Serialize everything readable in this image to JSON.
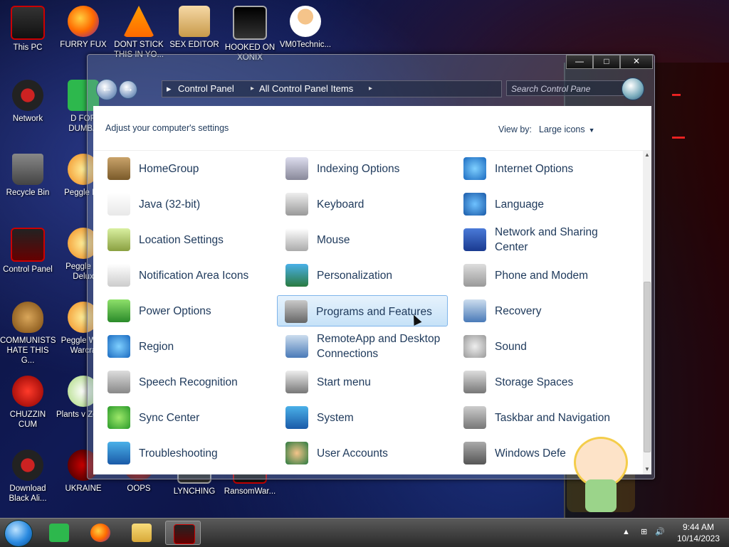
{
  "desktop_icons": [
    {
      "label": "This PC",
      "icon": "this-pc-icon"
    },
    {
      "label": "FURRY FUX",
      "icon": "firefox-icon"
    },
    {
      "label": "DONT STICK THIS IN YO...",
      "icon": "vlc-icon"
    },
    {
      "label": "SEX EDITOR",
      "icon": "hxd-icon"
    },
    {
      "label": "HOOKED ON XONIX",
      "icon": "xonix-icon"
    },
    {
      "label": "VM0Technic...",
      "icon": "doctor-icon"
    },
    {
      "label": "Network",
      "icon": "network-icon"
    },
    {
      "label": "D FOR DUMBA",
      "icon": "green-app-icon"
    },
    {
      "label": "Recycle Bin",
      "icon": "recycle-bin-icon"
    },
    {
      "label": "Peggle De",
      "icon": "peggle-icon"
    },
    {
      "label": "Control Panel",
      "icon": "control-panel-icon"
    },
    {
      "label": "Peggle Ni Delux",
      "icon": "peggle-icon"
    },
    {
      "label": "COMMUNISTS HATE THIS G...",
      "icon": "money-bag-icon"
    },
    {
      "label": "Peggle W of Warcra",
      "icon": "peggle-icon"
    },
    {
      "label": "CHUZZIN CUM",
      "icon": "chuzzle-icon"
    },
    {
      "label": "Plants v Zombi",
      "icon": "plant-icon"
    },
    {
      "label": "Download Black Ali...",
      "icon": "alien-icon"
    },
    {
      "label": "UKRAINE",
      "icon": "radiation-icon"
    },
    {
      "label": "OOPS",
      "icon": "oops-icon"
    },
    {
      "label": "LYNCHING",
      "icon": "lynching-icon"
    },
    {
      "label": "RansomWar...",
      "icon": "ransomware-icon"
    }
  ],
  "window": {
    "controls": {
      "minimize": "—",
      "maximize": "□",
      "close": "✕"
    },
    "address": {
      "crumbs": [
        "Control Panel",
        "All Control Panel Items"
      ],
      "separator": "▸"
    },
    "search_placeholder": "Search Control Pane",
    "header": {
      "adjust_text": "Adjust your computer's settings",
      "view_by_label": "View by:",
      "view_by_value": "Large icons",
      "dropdown_arrow": "▼"
    },
    "items": [
      {
        "label": "HomeGroup",
        "icon": "homegroup-icon"
      },
      {
        "label": "Indexing Options",
        "icon": "indexing-icon"
      },
      {
        "label": "Internet Options",
        "icon": "internet-options-icon"
      },
      {
        "label": "Java (32-bit)",
        "icon": "java-icon"
      },
      {
        "label": "Keyboard",
        "icon": "keyboard-icon"
      },
      {
        "label": "Language",
        "icon": "language-icon"
      },
      {
        "label": "Location Settings",
        "icon": "location-icon"
      },
      {
        "label": "Mouse",
        "icon": "mouse-icon"
      },
      {
        "label": "Network and Sharing Center",
        "icon": "network-sharing-icon"
      },
      {
        "label": "Notification Area Icons",
        "icon": "notification-icon"
      },
      {
        "label": "Personalization",
        "icon": "personalization-icon"
      },
      {
        "label": "Phone and Modem",
        "icon": "phone-icon"
      },
      {
        "label": "Power Options",
        "icon": "power-icon"
      },
      {
        "label": "Programs and Features",
        "icon": "programs-icon",
        "selected": true
      },
      {
        "label": "Recovery",
        "icon": "recovery-icon"
      },
      {
        "label": "Region",
        "icon": "region-icon"
      },
      {
        "label": "RemoteApp and Desktop Connections",
        "icon": "remoteapp-icon"
      },
      {
        "label": "Sound",
        "icon": "sound-icon"
      },
      {
        "label": "Speech Recognition",
        "icon": "microphone-icon"
      },
      {
        "label": "Start menu",
        "icon": "start-menu-icon"
      },
      {
        "label": "Storage Spaces",
        "icon": "storage-icon"
      },
      {
        "label": "Sync Center",
        "icon": "sync-icon"
      },
      {
        "label": "System",
        "icon": "system-icon"
      },
      {
        "label": "Taskbar and Navigation",
        "icon": "taskbar-nav-icon"
      },
      {
        "label": "Troubleshooting",
        "icon": "troubleshooting-icon"
      },
      {
        "label": "User Accounts",
        "icon": "user-accounts-icon"
      },
      {
        "label": "Windows Defe",
        "icon": "firewall-icon"
      }
    ],
    "scroll": {
      "up": "▲",
      "down": "▼"
    }
  },
  "taskbar": {
    "apps": [
      {
        "name": "green-app",
        "active": false
      },
      {
        "name": "firefox",
        "active": false
      },
      {
        "name": "file-explorer",
        "active": false
      },
      {
        "name": "control-panel",
        "active": true
      }
    ],
    "tray": {
      "chevron": "▲",
      "speaker": "🔊"
    },
    "time": "9:44 AM",
    "date": "10/14/2023"
  },
  "colors": {
    "link_text": "#1e395b",
    "selection_bg": "#cde6fa",
    "selection_border": "#7eb4ea"
  }
}
